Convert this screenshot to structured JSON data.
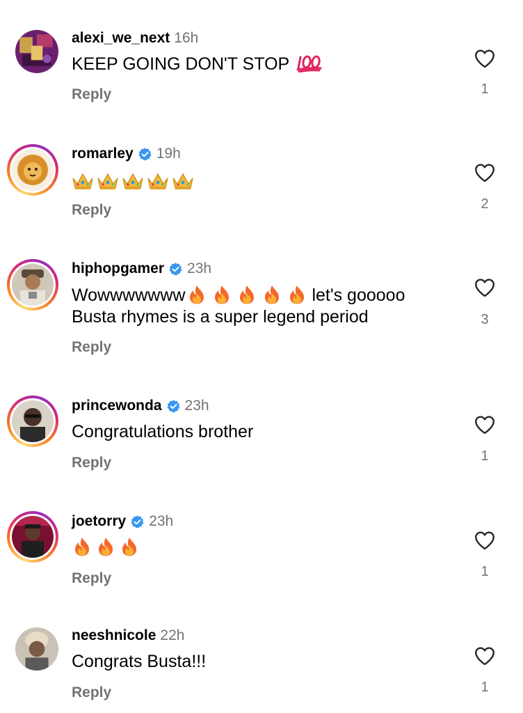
{
  "comments": [
    {
      "username": "alexi_we_next",
      "verified": false,
      "time": "16h",
      "text": "KEEP GOING DON'T STOP",
      "emoji": [
        "hundred-points"
      ],
      "reply_label": "Reply",
      "likes": "1"
    },
    {
      "username": "romarley",
      "verified": true,
      "time": "19h",
      "text": "",
      "emoji": [
        "crown",
        "crown",
        "crown",
        "crown",
        "crown"
      ],
      "reply_label": "Reply",
      "likes": "2"
    },
    {
      "username": "hiphopgamer",
      "verified": true,
      "time": "23h",
      "text_line1_start": "Wowwwwwww",
      "emoji": [
        "fire",
        "fire",
        "fire",
        "fire",
        "fire"
      ],
      "text_line1_end": "let's gooooo",
      "text_line2": "Busta rhymes is a super legend period",
      "reply_label": "Reply",
      "likes": "3"
    },
    {
      "username": "princewonda",
      "verified": true,
      "time": "23h",
      "text": "Congratulations brother",
      "reply_label": "Reply",
      "likes": "1"
    },
    {
      "username": "joetorry",
      "verified": true,
      "time": "23h",
      "text": "",
      "emoji": [
        "fire",
        "fire",
        "fire"
      ],
      "reply_label": "Reply",
      "likes": "1"
    },
    {
      "username": "neeshnicole",
      "verified": false,
      "time": "22h",
      "text": "Congrats Busta!!!",
      "reply_label": "Reply",
      "likes": "1"
    }
  ],
  "colors": {
    "text": "#000000",
    "secondary": "#737373",
    "verified": "#3897f0",
    "story_ring_start": "#feda75",
    "story_ring_end": "#d62976"
  },
  "icons": {
    "like": "heart-outline-icon",
    "verified": "verified-badge-icon"
  }
}
